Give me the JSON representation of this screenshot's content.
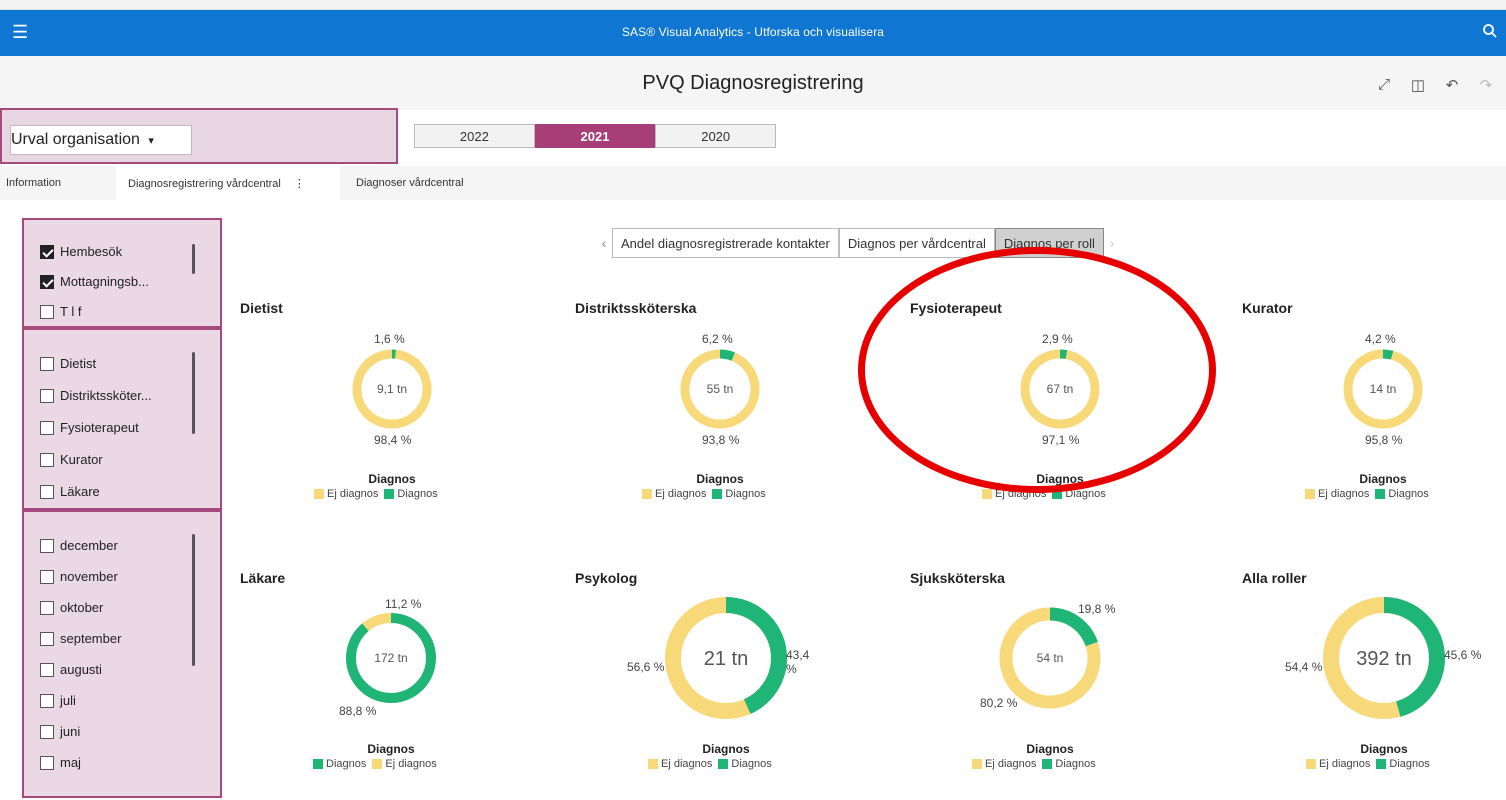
{
  "app": {
    "title": "SAS® Visual Analytics - Utforska och visualisera",
    "menu_icon": "hamburger-menu-icon",
    "search_icon": "search-icon"
  },
  "report": {
    "title": "PVQ Diagnosregistrering",
    "tools": [
      "expand-icon",
      "panel-icon",
      "undo-icon",
      "redo-icon"
    ]
  },
  "urval": {
    "label": "Urval organisation",
    "caret": "▾"
  },
  "years": [
    {
      "label": "2022",
      "active": false
    },
    {
      "label": "2021",
      "active": true
    },
    {
      "label": "2020",
      "active": false
    }
  ],
  "tabs": [
    {
      "label": "Information"
    },
    {
      "label": "Diagnosregistrering vårdcentral"
    },
    {
      "label": "Diagnoser vårdcentral"
    }
  ],
  "tab_more": "⋮",
  "filters": {
    "contact_types": [
      {
        "label": "Hembesök",
        "checked": true
      },
      {
        "label": "Mottagningsb...",
        "checked": true
      },
      {
        "label": "T l f",
        "checked": false
      }
    ],
    "roles": [
      {
        "label": "Dietist",
        "checked": false
      },
      {
        "label": "Distriktssköter...",
        "checked": false
      },
      {
        "label": "Fysioterapeut",
        "checked": false
      },
      {
        "label": "Kurator",
        "checked": false
      },
      {
        "label": "Läkare",
        "checked": false
      }
    ],
    "months": [
      {
        "label": "december",
        "checked": false
      },
      {
        "label": "november",
        "checked": false
      },
      {
        "label": "oktober",
        "checked": false
      },
      {
        "label": "september",
        "checked": false
      },
      {
        "label": "augusti",
        "checked": false
      },
      {
        "label": "juli",
        "checked": false
      },
      {
        "label": "juni",
        "checked": false
      },
      {
        "label": "maj",
        "checked": false
      }
    ]
  },
  "subtabs": {
    "prev": "‹",
    "next": "›",
    "items": [
      {
        "label": "Andel diagnosregistrerade kontakter",
        "active": false
      },
      {
        "label": "Diagnos per vårdcentral",
        "active": false
      },
      {
        "label": "Diagnos per roll",
        "active": true
      }
    ]
  },
  "colors": {
    "ej_diagnos": "#f8d97a",
    "diagnos": "#1eb577",
    "accent": "#a73e78",
    "topbar": "#0f76d1"
  },
  "legend_title": "Diagnos",
  "chart_data": [
    {
      "type": "pie",
      "title": "Dietist",
      "center": "9,1 tn",
      "slices": [
        {
          "name": "Diagnos",
          "value": 1.6,
          "label": "1,6 %"
        },
        {
          "name": "Ej diagnos",
          "value": 98.4,
          "label": "98,4 %"
        }
      ],
      "legend": [
        "Ej diagnos",
        "Diagnos"
      ]
    },
    {
      "type": "pie",
      "title": "Distriktssköterska",
      "center": "55 tn",
      "slices": [
        {
          "name": "Diagnos",
          "value": 6.2,
          "label": "6,2 %"
        },
        {
          "name": "Ej diagnos",
          "value": 93.8,
          "label": "93,8 %"
        }
      ],
      "legend": [
        "Ej diagnos",
        "Diagnos"
      ]
    },
    {
      "type": "pie",
      "title": "Fysioterapeut",
      "center": "67 tn",
      "slices": [
        {
          "name": "Diagnos",
          "value": 2.9,
          "label": "2,9 %"
        },
        {
          "name": "Ej diagnos",
          "value": 97.1,
          "label": "97,1 %"
        }
      ],
      "legend": [
        "Ej diagnos",
        "Diagnos"
      ]
    },
    {
      "type": "pie",
      "title": "Kurator",
      "center": "14 tn",
      "slices": [
        {
          "name": "Diagnos",
          "value": 4.2,
          "label": "4,2 %"
        },
        {
          "name": "Ej diagnos",
          "value": 95.8,
          "label": "95,8 %"
        }
      ],
      "legend": [
        "Ej diagnos",
        "Diagnos"
      ]
    },
    {
      "type": "pie",
      "title": "Läkare",
      "center": "172 tn",
      "slices": [
        {
          "name": "Ej diagnos",
          "value": 11.2,
          "label": "11,2 %"
        },
        {
          "name": "Diagnos",
          "value": 88.8,
          "label": "88,8 %"
        }
      ],
      "legend": [
        "Diagnos",
        "Ej diagnos"
      ]
    },
    {
      "type": "pie",
      "title": "Psykolog",
      "center": "21 tn",
      "slices": [
        {
          "name": "Diagnos",
          "value": 43.4,
          "label": "43,4 %"
        },
        {
          "name": "Ej diagnos",
          "value": 56.6,
          "label": "56,6 %"
        }
      ],
      "legend": [
        "Ej diagnos",
        "Diagnos"
      ]
    },
    {
      "type": "pie",
      "title": "Sjuksköterska",
      "center": "54 tn",
      "slices": [
        {
          "name": "Diagnos",
          "value": 19.8,
          "label": "19,8 %"
        },
        {
          "name": "Ej diagnos",
          "value": 80.2,
          "label": "80,2 %"
        }
      ],
      "legend": [
        "Ej diagnos",
        "Diagnos"
      ]
    },
    {
      "type": "pie",
      "title": "Alla roller",
      "center": "392 tn",
      "slices": [
        {
          "name": "Diagnos",
          "value": 45.6,
          "label": "45,6 %"
        },
        {
          "name": "Ej diagnos",
          "value": 54.4,
          "label": "54,4 %"
        }
      ],
      "legend": [
        "Ej diagnos",
        "Diagnos"
      ]
    }
  ]
}
